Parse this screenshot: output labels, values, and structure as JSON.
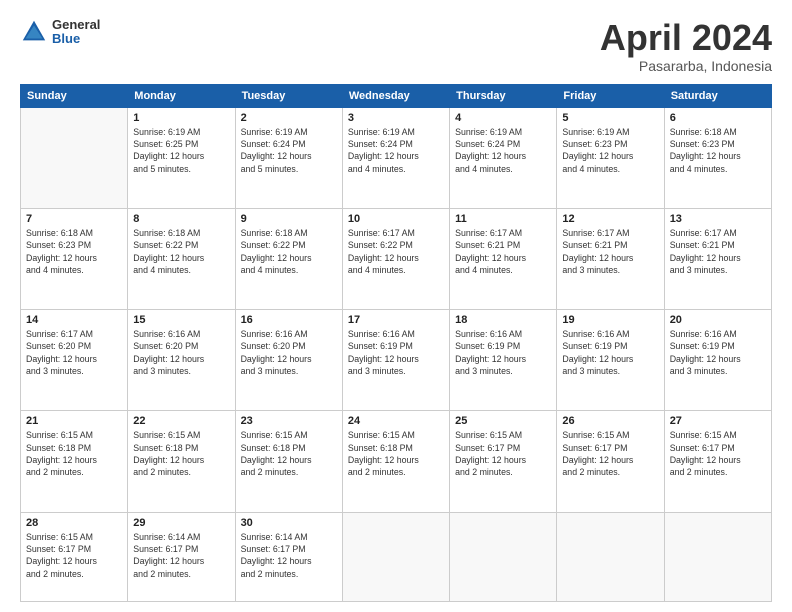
{
  "header": {
    "logo": {
      "general": "General",
      "blue": "Blue"
    },
    "title": "April 2024",
    "subtitle": "Pasararba, Indonesia"
  },
  "weekdays": [
    "Sunday",
    "Monday",
    "Tuesday",
    "Wednesday",
    "Thursday",
    "Friday",
    "Saturday"
  ],
  "weeks": [
    [
      {
        "day": "",
        "info": ""
      },
      {
        "day": "1",
        "info": "Sunrise: 6:19 AM\nSunset: 6:25 PM\nDaylight: 12 hours\nand 5 minutes."
      },
      {
        "day": "2",
        "info": "Sunrise: 6:19 AM\nSunset: 6:24 PM\nDaylight: 12 hours\nand 5 minutes."
      },
      {
        "day": "3",
        "info": "Sunrise: 6:19 AM\nSunset: 6:24 PM\nDaylight: 12 hours\nand 4 minutes."
      },
      {
        "day": "4",
        "info": "Sunrise: 6:19 AM\nSunset: 6:24 PM\nDaylight: 12 hours\nand 4 minutes."
      },
      {
        "day": "5",
        "info": "Sunrise: 6:19 AM\nSunset: 6:23 PM\nDaylight: 12 hours\nand 4 minutes."
      },
      {
        "day": "6",
        "info": "Sunrise: 6:18 AM\nSunset: 6:23 PM\nDaylight: 12 hours\nand 4 minutes."
      }
    ],
    [
      {
        "day": "7",
        "info": "Sunrise: 6:18 AM\nSunset: 6:23 PM\nDaylight: 12 hours\nand 4 minutes."
      },
      {
        "day": "8",
        "info": "Sunrise: 6:18 AM\nSunset: 6:22 PM\nDaylight: 12 hours\nand 4 minutes."
      },
      {
        "day": "9",
        "info": "Sunrise: 6:18 AM\nSunset: 6:22 PM\nDaylight: 12 hours\nand 4 minutes."
      },
      {
        "day": "10",
        "info": "Sunrise: 6:17 AM\nSunset: 6:22 PM\nDaylight: 12 hours\nand 4 minutes."
      },
      {
        "day": "11",
        "info": "Sunrise: 6:17 AM\nSunset: 6:21 PM\nDaylight: 12 hours\nand 4 minutes."
      },
      {
        "day": "12",
        "info": "Sunrise: 6:17 AM\nSunset: 6:21 PM\nDaylight: 12 hours\nand 3 minutes."
      },
      {
        "day": "13",
        "info": "Sunrise: 6:17 AM\nSunset: 6:21 PM\nDaylight: 12 hours\nand 3 minutes."
      }
    ],
    [
      {
        "day": "14",
        "info": "Sunrise: 6:17 AM\nSunset: 6:20 PM\nDaylight: 12 hours\nand 3 minutes."
      },
      {
        "day": "15",
        "info": "Sunrise: 6:16 AM\nSunset: 6:20 PM\nDaylight: 12 hours\nand 3 minutes."
      },
      {
        "day": "16",
        "info": "Sunrise: 6:16 AM\nSunset: 6:20 PM\nDaylight: 12 hours\nand 3 minutes."
      },
      {
        "day": "17",
        "info": "Sunrise: 6:16 AM\nSunset: 6:19 PM\nDaylight: 12 hours\nand 3 minutes."
      },
      {
        "day": "18",
        "info": "Sunrise: 6:16 AM\nSunset: 6:19 PM\nDaylight: 12 hours\nand 3 minutes."
      },
      {
        "day": "19",
        "info": "Sunrise: 6:16 AM\nSunset: 6:19 PM\nDaylight: 12 hours\nand 3 minutes."
      },
      {
        "day": "20",
        "info": "Sunrise: 6:16 AM\nSunset: 6:19 PM\nDaylight: 12 hours\nand 3 minutes."
      }
    ],
    [
      {
        "day": "21",
        "info": "Sunrise: 6:15 AM\nSunset: 6:18 PM\nDaylight: 12 hours\nand 2 minutes."
      },
      {
        "day": "22",
        "info": "Sunrise: 6:15 AM\nSunset: 6:18 PM\nDaylight: 12 hours\nand 2 minutes."
      },
      {
        "day": "23",
        "info": "Sunrise: 6:15 AM\nSunset: 6:18 PM\nDaylight: 12 hours\nand 2 minutes."
      },
      {
        "day": "24",
        "info": "Sunrise: 6:15 AM\nSunset: 6:18 PM\nDaylight: 12 hours\nand 2 minutes."
      },
      {
        "day": "25",
        "info": "Sunrise: 6:15 AM\nSunset: 6:17 PM\nDaylight: 12 hours\nand 2 minutes."
      },
      {
        "day": "26",
        "info": "Sunrise: 6:15 AM\nSunset: 6:17 PM\nDaylight: 12 hours\nand 2 minutes."
      },
      {
        "day": "27",
        "info": "Sunrise: 6:15 AM\nSunset: 6:17 PM\nDaylight: 12 hours\nand 2 minutes."
      }
    ],
    [
      {
        "day": "28",
        "info": "Sunrise: 6:15 AM\nSunset: 6:17 PM\nDaylight: 12 hours\nand 2 minutes."
      },
      {
        "day": "29",
        "info": "Sunrise: 6:14 AM\nSunset: 6:17 PM\nDaylight: 12 hours\nand 2 minutes."
      },
      {
        "day": "30",
        "info": "Sunrise: 6:14 AM\nSunset: 6:17 PM\nDaylight: 12 hours\nand 2 minutes."
      },
      {
        "day": "",
        "info": ""
      },
      {
        "day": "",
        "info": ""
      },
      {
        "day": "",
        "info": ""
      },
      {
        "day": "",
        "info": ""
      }
    ]
  ]
}
